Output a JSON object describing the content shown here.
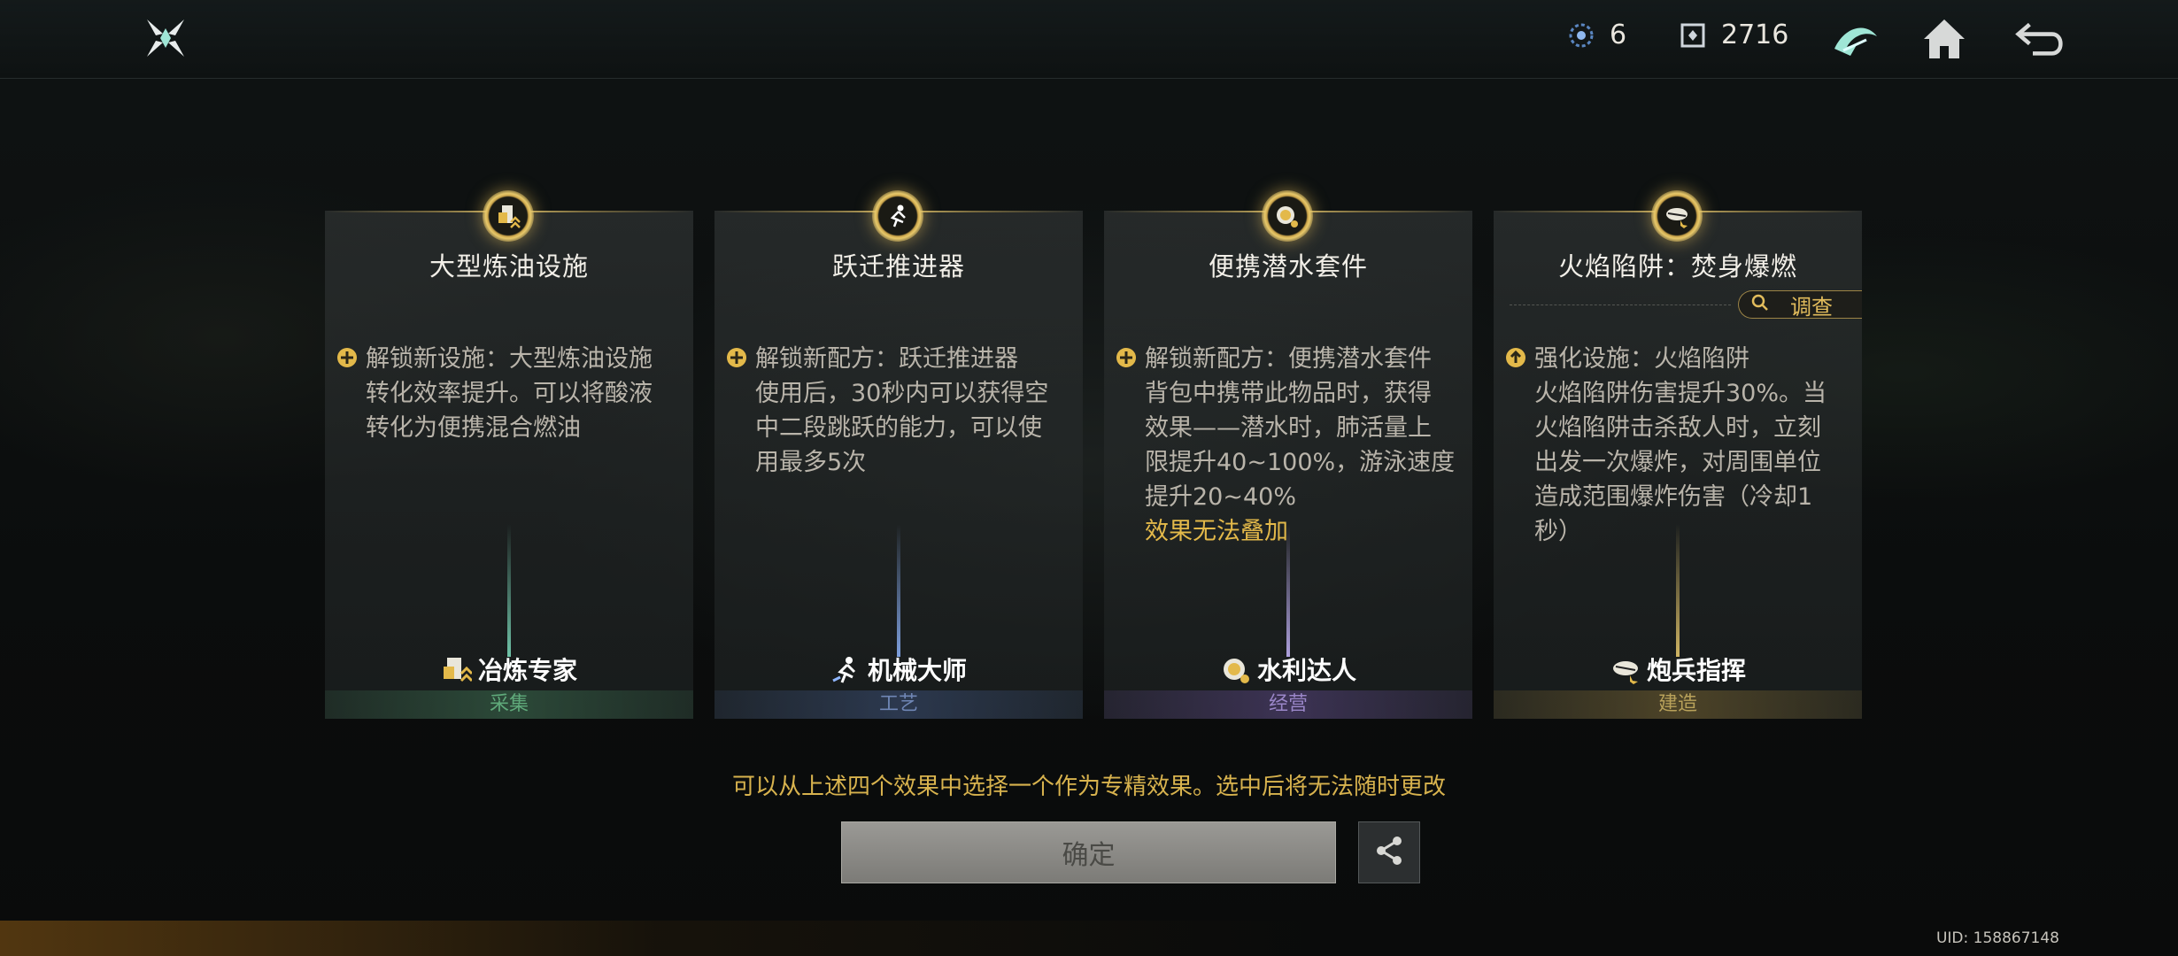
{
  "header": {
    "energy_count": "6",
    "currency_count": "2716",
    "icons": [
      "app-logo-icon",
      "energy-icon",
      "currency-icon",
      "faction-icon",
      "home-icon",
      "back-icon"
    ]
  },
  "cards": [
    {
      "title": "大型炼油设施",
      "effect_lines": [
        "解锁新设施：大型炼油设施",
        "转化效率提升。可以将酸液",
        "转化为便携混合燃油"
      ],
      "warning": "",
      "specialty": "冶炼专家",
      "category": "采集",
      "category_color": "#5fa97a",
      "beam_color": "#7fe0c0"
    },
    {
      "title": "跃迁推进器",
      "effect_lines": [
        "解锁新配方：跃迁推进器",
        "使用后，30秒内可以获得空",
        "中二段跳跃的能力，可以使",
        "用最多5次"
      ],
      "warning": "",
      "specialty": "机械大师",
      "category": "工艺",
      "category_color": "#6f86b5",
      "beam_color": "#8fb6ff"
    },
    {
      "title": "便携潜水套件",
      "effect_lines": [
        "解锁新配方：便携潜水套件",
        "背包中携带此物品时，获得",
        "效果——潜水时，肺活量上",
        "限提升40~100%，游泳速度",
        "提升20~40%"
      ],
      "warning": "效果无法叠加",
      "specialty": "水利达人",
      "category": "经营",
      "category_color": "#9a86c8",
      "beam_color": "#c8b8ff"
    },
    {
      "title": "火焰陷阱：焚身爆燃",
      "effect_lines": [
        "强化设施：火焰陷阱",
        "火焰陷阱伤害提升30%。当",
        "火焰陷阱击杀敌人时，立刻",
        "出发一次爆炸，对周围单位",
        "造成范围爆炸伤害（冷却1",
        "秒）"
      ],
      "warning": "",
      "specialty": "炮兵指挥",
      "category": "建造",
      "category_color": "#b8a15a",
      "beam_color": "#f0d070",
      "investigate_label": "调查"
    }
  ],
  "hint_text": "可以从上述四个效果中选择一个作为专精效果。选中后将无法随时更改",
  "confirm_label": "确定",
  "uid_text": "UID: 158867148"
}
